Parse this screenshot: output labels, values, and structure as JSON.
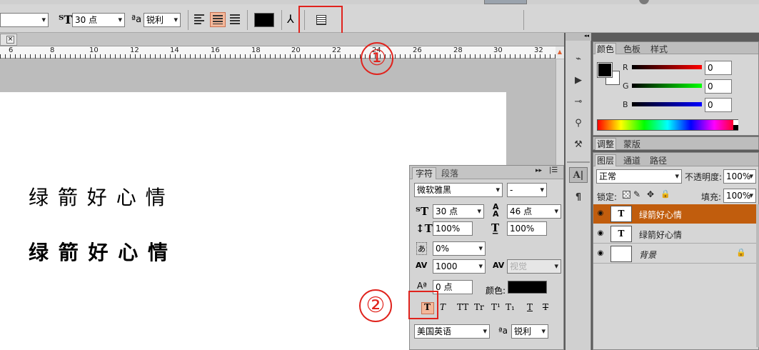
{
  "toolbar": {
    "font_size": "30 点",
    "aa_label": "a",
    "antialias": "锐利",
    "color_hex": "#000000"
  },
  "ruler": {
    "ticks": [
      "6",
      "8",
      "10",
      "12",
      "14",
      "16",
      "18",
      "20",
      "22",
      "24",
      "26",
      "28",
      "30",
      "32"
    ]
  },
  "canvas": {
    "text_regular": "绿 箭 好 心 情",
    "text_bold": "绿 箭 好 心 情"
  },
  "annotations": {
    "circle_1": "①",
    "circle_2": "②"
  },
  "character_panel": {
    "tabs": [
      "字符",
      "段落"
    ],
    "font_family": "微软雅黑",
    "font_style": "-",
    "font_size": "30 点",
    "leading": "46 点",
    "vertical_scale": "100%",
    "horizontal_scale": "100%",
    "tsume": "0%",
    "tracking": "1000",
    "kerning": "视觉",
    "baseline_shift": "0 点",
    "color_label": "颜色:",
    "style_buttons": [
      "T",
      "T",
      "TT",
      "Tr",
      "T¹",
      "T₁",
      "T",
      "T"
    ],
    "language": "美国英语",
    "aa_label": "a",
    "antialias": "锐利"
  },
  "color_panel": {
    "tabs": [
      "颜色",
      "色板",
      "样式"
    ],
    "r_label": "R",
    "g_label": "G",
    "b_label": "B",
    "r": "0",
    "g": "0",
    "b": "0"
  },
  "adjust_panel": {
    "tabs": [
      "调整",
      "蒙版"
    ]
  },
  "layers_panel": {
    "tabs": [
      "图层",
      "通道",
      "路径"
    ],
    "blend_mode": "正常",
    "opacity_label": "不透明度:",
    "opacity": "100%",
    "lock_label": "锁定:",
    "fill_label": "填充:",
    "fill": "100%",
    "layers": [
      {
        "name": "绿箭好心情",
        "thumb": "T"
      },
      {
        "name": "绿箭好心情",
        "thumb": "T"
      },
      {
        "name": "背景",
        "thumb": ""
      }
    ]
  }
}
